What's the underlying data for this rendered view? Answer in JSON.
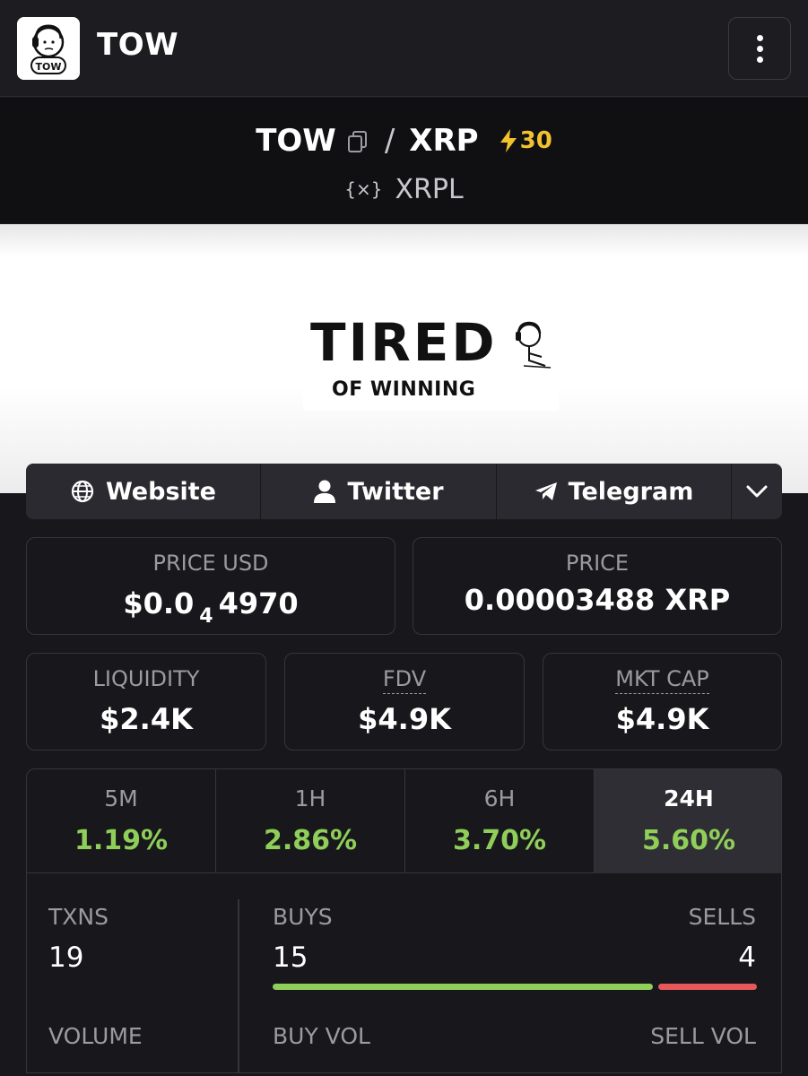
{
  "app": {
    "title": "TOW",
    "logo_text": "TOW"
  },
  "pair": {
    "base": "TOW",
    "separator": "/",
    "quote": "XRP",
    "boost_count": "30",
    "chain_icon": "{×}",
    "chain": "XRPL"
  },
  "banner": {
    "headline": "TIRED",
    "subline": "OF WINNING"
  },
  "links": [
    {
      "label": "Website",
      "icon": "globe-icon"
    },
    {
      "label": "Twitter",
      "icon": "user-icon"
    },
    {
      "label": "Telegram",
      "icon": "telegram-icon"
    }
  ],
  "stats": {
    "price_usd": {
      "label": "PRICE USD",
      "prefix": "$0.0",
      "zeros": "4",
      "digits": "4970"
    },
    "price": {
      "label": "PRICE",
      "value": "0.00003488 XRP"
    },
    "liquidity": {
      "label": "LIQUIDITY",
      "value": "$2.4K"
    },
    "fdv": {
      "label": "FDV",
      "value": "$4.9K"
    },
    "mkt_cap": {
      "label": "MKT CAP",
      "value": "$4.9K"
    }
  },
  "timeframes": [
    {
      "label": "5M",
      "change": "1.19%"
    },
    {
      "label": "1H",
      "change": "2.86%"
    },
    {
      "label": "6H",
      "change": "3.70%"
    },
    {
      "label": "24H",
      "change": "5.60%",
      "active": true
    }
  ],
  "txns": {
    "txns_label": "TXNS",
    "txns_value": "19",
    "buys_label": "BUYS",
    "buys_value": "15",
    "sells_label": "SELLS",
    "sells_value": "4",
    "buy_fraction": 0.79,
    "volume_label": "VOLUME",
    "buy_vol_label": "BUY VOL",
    "sell_vol_label": "SELL VOL"
  },
  "colors": {
    "positive": "#8fce59",
    "negative": "#e8575a",
    "boost": "#f2c12e"
  }
}
